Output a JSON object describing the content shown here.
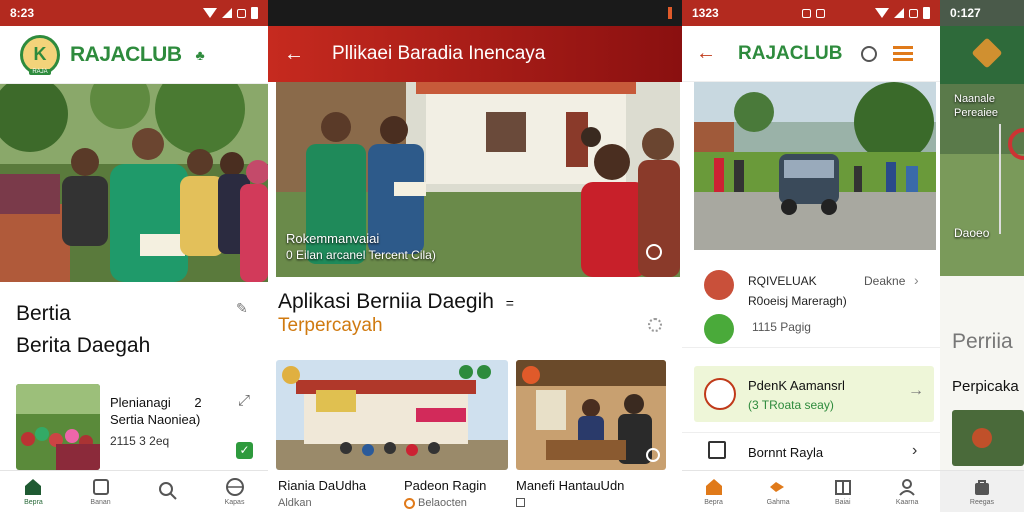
{
  "panel1": {
    "status_time": "8:23",
    "logo_badge": "RAJA",
    "brand": "RAJACLUB",
    "heading_line1": "Bertia",
    "heading_line2": "Berita Daegah",
    "news_title_line1": "Plenianagi",
    "news_title_num": "2",
    "news_title_line2": "Sertia Naoniea)",
    "news_meta": "2115 3 2eq",
    "nav": [
      "Bepra",
      "Banan",
      "",
      "Kapas"
    ]
  },
  "panel2": {
    "toolbar_title": "Pllikaei Baradia Inencaya",
    "hero_caption_line1": "Rokemmanvaiai",
    "hero_caption_line2": "0 Eilan arcanel Tercent Cila)",
    "headline": "Aplikasi Berniia Daegih",
    "headline_dash": "=",
    "subheadline": "Terpercayah",
    "card1_title": "Riania DaUdha",
    "card1_sub": "Aldkan",
    "card2_title": "Padeon Ragin",
    "card2_sub": "Belaocten",
    "card3_title": "Manefi HantauUdn"
  },
  "panel3": {
    "status_time": "1323",
    "brand": "RAJACLUB",
    "item1_title": "RQIVELUAK",
    "item1_tag": "Deakne",
    "item1_sub": "R0oeisj Mareragh)",
    "item2_meta": "1115 Pagig",
    "highlight_title": "PdenK Aamansrl",
    "highlight_sub": "(3 TRoata seay)",
    "list_item": "Bornnt Rayla",
    "nav": [
      "Bepra",
      "Gahma",
      "Baiai",
      "Kaarna"
    ]
  },
  "panel4": {
    "status_time": "0:127",
    "photo_caption": "Naanale Pereaiee",
    "photo_caption2": "Daoeo",
    "heading": "Perriia",
    "subheading": "Perpicaka",
    "nav": [
      "Reegas"
    ]
  },
  "colors": {
    "green": "#2e8b3d",
    "red": "#b01e1e",
    "orange": "#e07a1a",
    "yellow": "#e3a622",
    "highlight_bg": "#eef6d8"
  }
}
